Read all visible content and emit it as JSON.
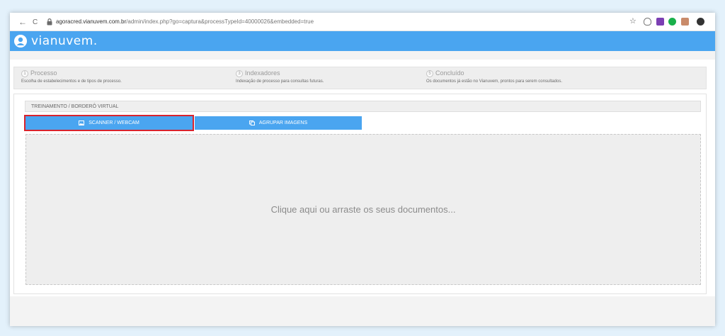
{
  "browser": {
    "back": "←",
    "reload": "C",
    "url_host": "agoracred.vianuvem.com.br",
    "url_path": "/admin/index.php?go=captura&processTypeId=40000026&embedded=true",
    "star": "☆",
    "menu": "⋮"
  },
  "app": {
    "logo_text": "vianuvem."
  },
  "steps": [
    {
      "num": "1",
      "title": "Processo",
      "desc": "Escolha de estabelecimentos e de tipos de processo."
    },
    {
      "num": "3",
      "title": "Indexadores",
      "desc": "Indexação de processo para consultas futuras."
    },
    {
      "num": "5",
      "title": "Concluído",
      "desc": "Os documentos já estão no Vianuvem, prontos para serem consultados."
    }
  ],
  "main": {
    "section_title": "TREINAMENTO / BORDERÔ VIRTUAL",
    "tabs": [
      {
        "label": "SCANNER / WEBCAM",
        "icon": "image-icon",
        "active": true
      },
      {
        "label": "AGRUPAR IMAGENS",
        "icon": "copy-icon",
        "active": false
      }
    ],
    "dropzone_text": "Clique aqui ou arraste os seus documentos..."
  },
  "colors": {
    "brand_blue": "#4aa5f0",
    "active_outline": "#d9232d"
  }
}
